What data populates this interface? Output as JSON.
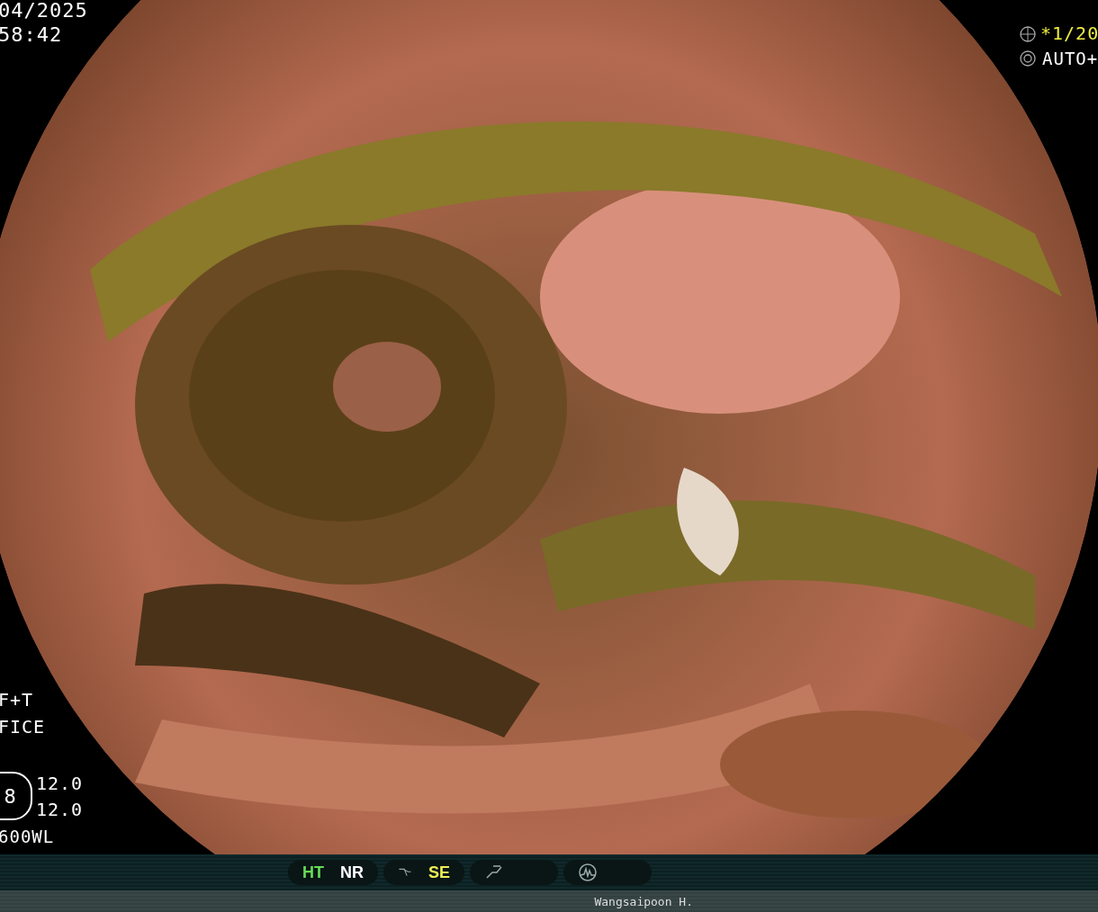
{
  "overlay_left": {
    "date": "04/2025",
    "time": "58:42",
    "mode_1": "F+T",
    "mode_2": "FICE",
    "scope_number": "8",
    "value_1": "12.0",
    "value_2": "12.0",
    "scope_model": "600WL"
  },
  "overlay_right": {
    "shutter": "*1/20",
    "iris": "AUTO+"
  },
  "status_bar": {
    "groups": [
      {
        "kind": "plain",
        "labels": [
          {
            "text": "HT",
            "color": "#66dd55"
          },
          {
            "text": "NR",
            "color": "#ffffff"
          }
        ]
      },
      {
        "kind": "curve",
        "labels": [
          {
            "text": "SE",
            "color": "#eeee55"
          }
        ]
      },
      {
        "kind": "slope"
      },
      {
        "kind": "wave"
      }
    ]
  },
  "operator": "Wangsaipoon H."
}
